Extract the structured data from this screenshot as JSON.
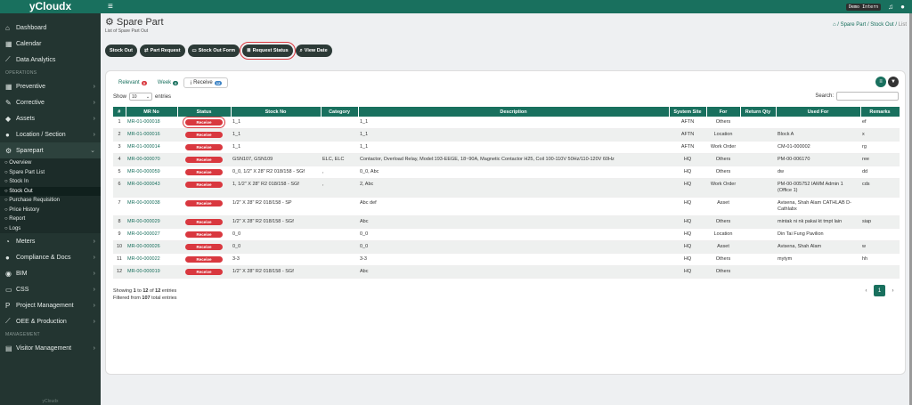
{
  "app": {
    "brand": "yCloudx",
    "footer": "yCloudx"
  },
  "topbar": {
    "user": "Demo Intern"
  },
  "sidebar": {
    "items_top": [
      {
        "label": "Dashboard",
        "icon": "home-icon"
      },
      {
        "label": "Calendar",
        "icon": "calendar-icon"
      },
      {
        "label": "Data Analytics",
        "icon": "chart-icon"
      }
    ],
    "section_operations": "OPERATIONS",
    "items_ops": [
      {
        "label": "Preventive",
        "icon": "calendar-icon"
      },
      {
        "label": "Corrective",
        "icon": "wrench-icon"
      },
      {
        "label": "Assets",
        "icon": "tag-icon"
      },
      {
        "label": "Location / Section",
        "icon": "location-icon"
      },
      {
        "label": "Sparepart",
        "icon": "sparepart-icon"
      }
    ],
    "sub_items": [
      "Overview",
      "Spare Part List",
      "Stock In",
      "Stock Out",
      "Purchase Requisition",
      "Price History",
      "Report",
      "Logs"
    ],
    "items_after": [
      {
        "label": "Meters",
        "icon": "meter-icon"
      },
      {
        "label": "Compliance & Docs",
        "icon": "circle-icon"
      },
      {
        "label": "BIM",
        "icon": "bim-icon"
      },
      {
        "label": "CSS",
        "icon": "chat-icon"
      },
      {
        "label": "Project Management",
        "icon": "project-icon"
      },
      {
        "label": "OEE & Production",
        "icon": "chart-icon"
      }
    ],
    "section_management": "MANAGEMENT",
    "items_mgmt": [
      {
        "label": "Visitor Management",
        "icon": "id-card-icon"
      }
    ]
  },
  "page": {
    "title": "Spare Part",
    "subtitle": "List of Spare Part Out",
    "breadcrumb": {
      "sep": "/",
      "items": [
        "Spare Part",
        "Stock Out",
        "List"
      ]
    }
  },
  "actions": [
    "Stock Out",
    "Part Request",
    "Stock Out Form",
    "Request Status",
    "View Date"
  ],
  "tabs": [
    {
      "label": "Relevant",
      "count": "0"
    },
    {
      "label": "Week",
      "count": "0"
    },
    {
      "label": "Receive",
      "count": "12"
    }
  ],
  "list": {
    "show_label": "Show",
    "show_value": "10",
    "entries_label": "entries",
    "search_label": "Search:",
    "columns": [
      "#",
      "MR No",
      "Status",
      "Stock No",
      "Category",
      "Description",
      "System Site",
      "For",
      "Return Qty",
      "Used For",
      "Remarks"
    ],
    "rows": [
      {
        "n": "1",
        "mr": "MR-01-000018",
        "status": "Receive",
        "stock": "1_1",
        "cat": "",
        "desc": "1_1",
        "site": "AFTN",
        "for": "Others",
        "ret": "",
        "used": "",
        "rem": "ef"
      },
      {
        "n": "2",
        "mr": "MR-01-000016",
        "status": "Receive",
        "stock": "1_1",
        "cat": "",
        "desc": "1_1",
        "site": "AFTN",
        "for": "Location",
        "ret": "",
        "used": "Block A",
        "rem": "x"
      },
      {
        "n": "3",
        "mr": "MR-01-000014",
        "status": "Receive",
        "stock": "1_1",
        "cat": "",
        "desc": "1_1",
        "site": "AFTN",
        "for": "Work Order",
        "ret": "",
        "used": "CM-01-000002",
        "rem": "rg"
      },
      {
        "n": "4",
        "mr": "MR-00-000070",
        "status": "Receive",
        "stock": "GSN107, GSN109",
        "cat": "ELC, ELC",
        "desc": "Contactor, Overload Relay, Model:193-EEGE, 18~90A, Magnetic Contactor H25, Coil 100-110V 50Hz/110-120V 60Hz",
        "site": "HQ",
        "for": "Others",
        "ret": "",
        "used": "PM-00-006170",
        "rem": "ree"
      },
      {
        "n": "5",
        "mr": "MR-00-000059",
        "status": "Receive",
        "stock": "0_0, 1/2\" X 28\" R2 018/158 - SGf",
        "cat": ",",
        "desc": "0_0, Abc",
        "site": "HQ",
        "for": "Others",
        "ret": "",
        "used": "dw",
        "rem": "dd"
      },
      {
        "n": "6",
        "mr": "MR-00-000043",
        "status": "Receive",
        "stock": "1, 1/2\" X 28\" R2 018/158 - SGf",
        "cat": ",",
        "desc": "2, Abc",
        "site": "HQ",
        "for": "Work Order",
        "ret": "",
        "used": "PM-00-005752 IAMM Admin 1 (Office 1)",
        "rem": "cds"
      },
      {
        "n": "7",
        "mr": "MR-00-000038",
        "status": "Receive",
        "stock": "1/2\" X 28\" R2 018/158 - SP",
        "cat": "",
        "desc": "Abc def",
        "site": "HQ",
        "for": "Asset",
        "ret": "",
        "used": "Avisena, Shah Alam CATHLAB D-Cathlabx",
        "rem": ""
      },
      {
        "n": "8",
        "mr": "MR-00-000029",
        "status": "Receive",
        "stock": "1/2\" X 28\" R2 018/158 - SGf",
        "cat": "",
        "desc": "Abc",
        "site": "HQ",
        "for": "Others",
        "ret": "",
        "used": "mintak ni nk pakai kt tmpt lain",
        "rem": "siap"
      },
      {
        "n": "9",
        "mr": "MR-00-000027",
        "status": "Receive",
        "stock": "0_0",
        "cat": "",
        "desc": "0_0",
        "site": "HQ",
        "for": "Location",
        "ret": "",
        "used": "Din Tai Fung Pavilion",
        "rem": ""
      },
      {
        "n": "10",
        "mr": "MR-00-000026",
        "status": "Receive",
        "stock": "0_0",
        "cat": "",
        "desc": "0_0",
        "site": "HQ",
        "for": "Asset",
        "ret": "",
        "used": "Avisena, Shah Alam",
        "rem": "w"
      },
      {
        "n": "11",
        "mr": "MR-00-000022",
        "status": "Receive",
        "stock": "3-3",
        "cat": "",
        "desc": "3-3",
        "site": "HQ",
        "for": "Others",
        "ret": "",
        "used": "mytym",
        "rem": "hh"
      },
      {
        "n": "12",
        "mr": "MR-00-000019",
        "status": "Receive",
        "stock": "1/2\" X 28\" R2 018/158 - SGf",
        "cat": "",
        "desc": "Abc",
        "site": "HQ",
        "for": "Others",
        "ret": "",
        "used": "",
        "rem": ""
      }
    ],
    "info_prefix": "Showing",
    "info_from": "1",
    "info_to_word": "to",
    "info_to": "12",
    "info_of_word": "of",
    "info_total": "12",
    "info_suffix": "entries",
    "filtered_prefix": "Filtered from",
    "filtered_total": "107",
    "filtered_suffix": "total entries",
    "page_current": "1"
  },
  "colors": {
    "brand": "#19705e",
    "sidebar": "#233531",
    "status_red": "#d9383f"
  }
}
